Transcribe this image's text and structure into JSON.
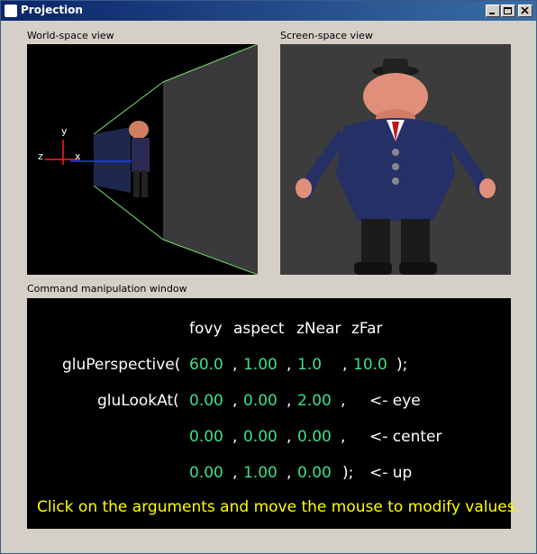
{
  "window": {
    "title": "Projection"
  },
  "panels": {
    "world_label": "World-space view",
    "screen_label": "Screen-space view",
    "command_label": "Command manipulation window"
  },
  "axes": {
    "y": "y",
    "z": "z",
    "x": "x"
  },
  "command": {
    "headers": [
      "fovy",
      "aspect",
      "zNear",
      "zFar"
    ],
    "perspective": {
      "func": "gluPerspective(",
      "args": [
        "60.0",
        "1.00",
        "1.0",
        "10.0"
      ],
      "end": ");"
    },
    "lookat_eye": {
      "func": "gluLookAt(",
      "args": [
        "0.00",
        "0.00",
        "2.00"
      ],
      "note": "<- eye"
    },
    "lookat_center": {
      "args": [
        "0.00",
        "0.00",
        "0.00"
      ],
      "note": "<- center"
    },
    "lookat_up": {
      "args": [
        "0.00",
        "1.00",
        "0.00"
      ],
      "end": ");",
      "note": "<- up"
    },
    "hint": "Click on the arguments and move the mouse to modify values."
  },
  "colors": {
    "value": "#3de08a",
    "hint": "#ffff00",
    "titlebar": "#0a246a"
  }
}
